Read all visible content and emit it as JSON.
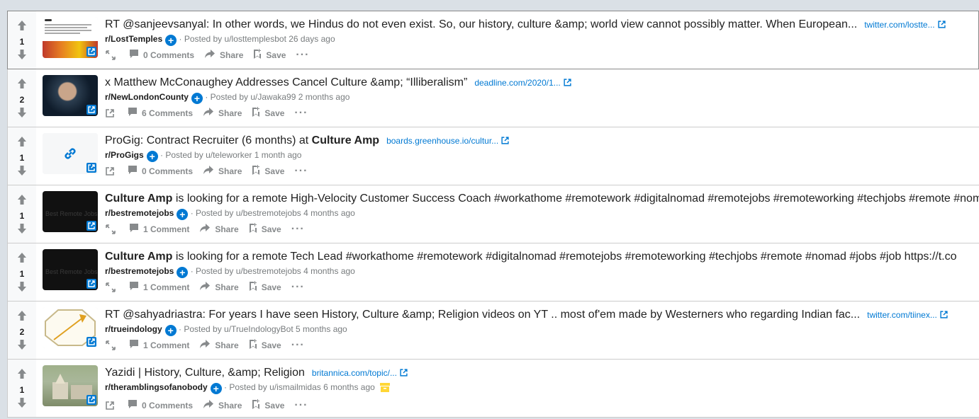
{
  "posts": [
    {
      "votes": "1",
      "title_parts": [
        {
          "text": "RT @sanjeevsanyal: In other words, we Hindus do not even exist. So, our history, culture &amp; world view cannot possibly matter. When European...",
          "bold": false
        }
      ],
      "domain": "twitter.com/lostte...",
      "subreddit": "r/LostTemples",
      "posted_by": "· Posted by u/losttemplesbot 26 days ago",
      "comments": "0 Comments",
      "share": "Share",
      "save": "Save",
      "thumb": "tweet",
      "expand": "expand"
    },
    {
      "votes": "2",
      "title_parts": [
        {
          "text": "x Matthew McConaughey Addresses Cancel Culture &amp; “Illiberalism”",
          "bold": false
        }
      ],
      "domain": "deadline.com/2020/1...",
      "subreddit": "r/NewLondonCounty",
      "posted_by": "· Posted by u/Jawaka99 2 months ago",
      "comments": "6 Comments",
      "share": "Share",
      "save": "Save",
      "thumb": "photo-dark",
      "expand": "link"
    },
    {
      "votes": "1",
      "title_parts": [
        {
          "text": "ProGig: Contract Recruiter (6 months) at ",
          "bold": false
        },
        {
          "text": "Culture Amp",
          "bold": true
        }
      ],
      "domain": "boards.greenhouse.io/cultur...",
      "subreddit": "r/ProGigs",
      "posted_by": "· Posted by u/teleworker 1 month ago",
      "comments": "0 Comments",
      "share": "Share",
      "save": "Save",
      "thumb": "link",
      "expand": "link"
    },
    {
      "votes": "1",
      "title_parts": [
        {
          "text": "Culture Amp",
          "bold": true
        },
        {
          "text": " is looking for a remote High-Velocity Customer Success Coach #workathome #remotework #digitalnomad #remotejobs #remoteworking #techjobs #remote #nomad",
          "bold": false
        }
      ],
      "domain": "",
      "subreddit": "r/bestremotejobs",
      "posted_by": "· Posted by u/bestremotejobs 4 months ago",
      "comments": "1 Comment",
      "share": "Share",
      "save": "Save",
      "thumb": "brj",
      "thumb_text": "Best Remote Jobs",
      "expand": "expand"
    },
    {
      "votes": "1",
      "title_parts": [
        {
          "text": "Culture Amp",
          "bold": true
        },
        {
          "text": " is looking for a remote Tech Lead #workathome #remotework #digitalnomad #remotejobs #remoteworking #techjobs #remote #nomad #jobs #job https://t.co",
          "bold": false
        }
      ],
      "domain": "",
      "subreddit": "r/bestremotejobs",
      "posted_by": "· Posted by u/bestremotejobs 4 months ago",
      "comments": "1 Comment",
      "share": "Share",
      "save": "Save",
      "thumb": "brj",
      "thumb_text": "Best Remote Jobs",
      "expand": "expand"
    },
    {
      "votes": "2",
      "title_parts": [
        {
          "text": "RT @sahyadriastra: For years I have seen History, Culture &amp; Religion videos on YT .. most of'em made by Westerners who regarding Indian fac...",
          "bold": false
        }
      ],
      "domain": "twitter.com/tiinex...",
      "subreddit": "r/trueindology",
      "posted_by": "· Posted by u/TrueIndologyBot 5 months ago",
      "comments": "1 Comment",
      "share": "Share",
      "save": "Save",
      "thumb": "octagon",
      "expand": "expand"
    },
    {
      "votes": "1",
      "title_parts": [
        {
          "text": "Yazidi | History, Culture, &amp; Religion",
          "bold": false
        }
      ],
      "domain": "britannica.com/topic/...",
      "subreddit": "r/theramblingsofanobody",
      "posted_by": "· Posted by u/ismailmidas 6 months ago",
      "comments": "0 Comments",
      "share": "Share",
      "save": "Save",
      "thumb": "temple",
      "expand": "link",
      "archived": true
    }
  ],
  "colors": {
    "accent": "#0079d3",
    "meta": "#787c7e",
    "action": "#878a8c",
    "archived": "#ffd635"
  }
}
